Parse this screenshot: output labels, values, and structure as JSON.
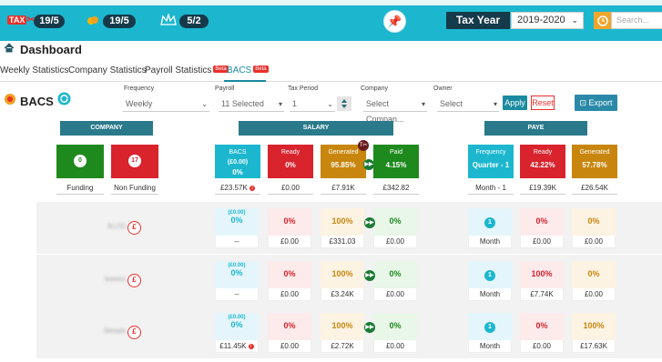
{
  "topbar": {
    "stat1": "19/5",
    "stat2": "19/5",
    "stat3": "5/2",
    "tax_year_label": "Tax Year",
    "tax_year_value": "2019-2020",
    "search_placeholder": "Search..."
  },
  "page": {
    "title": "Dashboard",
    "section_title": "BACS"
  },
  "tabs": [
    {
      "label": "Weekly Statistics"
    },
    {
      "label": "Company Statistics"
    },
    {
      "label": "Payroll Statistics",
      "badge": "Beta"
    },
    {
      "label": "BACS",
      "badge": "Beta"
    }
  ],
  "filters": {
    "frequency": {
      "label": "Frequency",
      "value": "Weekly"
    },
    "payroll": {
      "label": "Payroll",
      "value": "11 Selected"
    },
    "tax_period": {
      "label": "Tax Period",
      "value": "1"
    },
    "company": {
      "label": "Company",
      "value": "Select Compan..."
    },
    "owner": {
      "label": "Owner",
      "value": "Select"
    },
    "apply": "Apply",
    "reset": "Reset",
    "export": "Export"
  },
  "sections": {
    "company": "COMPANY",
    "salary": "SALARY",
    "paye": "PAYE"
  },
  "summary": {
    "company": [
      {
        "count": "0",
        "label": "Funding"
      },
      {
        "count": "17",
        "label": "Non Funding"
      }
    ],
    "salary": [
      {
        "title": "BACS",
        "sub": "(£0.00)",
        "value": "0%",
        "foot": "£23.57K"
      },
      {
        "title": "Ready",
        "value": "0%",
        "foot": "£0.00"
      },
      {
        "title": "Generated",
        "value": "95.85%",
        "foot": "£7.91K"
      },
      {
        "title": "Paid",
        "value": "4.15%",
        "foot": "£342.82"
      }
    ],
    "paye": [
      {
        "title": "Frequency",
        "value": "Quarter - 1",
        "foot": "Month - 1"
      },
      {
        "title": "Ready",
        "value": "42.22%",
        "foot": "£19.39K"
      },
      {
        "title": "Generated",
        "value": "57.78%",
        "foot": "£26.54K"
      }
    ]
  },
  "rows": [
    {
      "name": "B LTD",
      "salary": [
        {
          "sub": "(£0.00)",
          "value": "0%",
          "foot": "--"
        },
        {
          "value": "0%",
          "foot": "£0.00"
        },
        {
          "value": "100%",
          "foot": "£331.03"
        },
        {
          "value": "0%",
          "foot": "£0.00"
        }
      ],
      "paye": [
        {
          "value": "1",
          "foot": "Month"
        },
        {
          "value": "0%",
          "foot": "£0.00"
        },
        {
          "value": "0%",
          "foot": "£0.00"
        }
      ]
    },
    {
      "name": "brews1",
      "salary": [
        {
          "sub": "(£0.00)",
          "value": "0%",
          "foot": "--"
        },
        {
          "value": "0%",
          "foot": "£0.00"
        },
        {
          "value": "100%",
          "foot": "£3.24K"
        },
        {
          "value": "0%",
          "foot": "£0.00"
        }
      ],
      "paye": [
        {
          "value": "1",
          "foot": "Month"
        },
        {
          "value": "100%",
          "foot": "£7.74K"
        },
        {
          "value": "0%",
          "foot": "£0.00"
        }
      ]
    },
    {
      "name": "Shroufs",
      "salary": [
        {
          "sub": "(£0.00)",
          "value": "0%",
          "foot": "£11.45K"
        },
        {
          "value": "0%",
          "foot": "£0.00"
        },
        {
          "value": "100%",
          "foot": "£2.72K"
        },
        {
          "value": "0%",
          "foot": "£0.00"
        }
      ],
      "paye": [
        {
          "value": "1",
          "foot": "Month"
        },
        {
          "value": "0%",
          "foot": "£0.00"
        },
        {
          "value": "100%",
          "foot": "£17.63K"
        }
      ]
    }
  ],
  "colors": {
    "topbar": "#1cb7cf",
    "navy": "#153a4a",
    "teal": "#2a7a8b",
    "green": "#1e8a1e",
    "red": "#d9232d",
    "gold": "#c8860e",
    "cyan": "#1cb7cf"
  }
}
